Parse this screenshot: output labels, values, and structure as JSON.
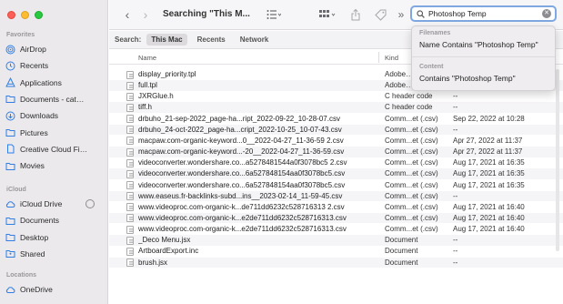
{
  "sidebar": {
    "sections": [
      {
        "title": "Favorites"
      },
      {
        "title": "iCloud"
      },
      {
        "title": "Locations"
      }
    ],
    "favorites": [
      {
        "label": "AirDrop",
        "icon": "airdrop-icon"
      },
      {
        "label": "Recents",
        "icon": "clock-icon"
      },
      {
        "label": "Applications",
        "icon": "applications-icon"
      },
      {
        "label": "Documents - cat…",
        "icon": "folder-icon"
      },
      {
        "label": "Downloads",
        "icon": "downloads-icon"
      },
      {
        "label": "Pictures",
        "icon": "folder-icon"
      },
      {
        "label": "Creative Cloud Fi…",
        "icon": "document-icon"
      },
      {
        "label": "Movies",
        "icon": "folder-icon"
      }
    ],
    "icloud": [
      {
        "label": "iCloud Drive",
        "icon": "cloud-icon"
      },
      {
        "label": "Documents",
        "icon": "folder-icon"
      },
      {
        "label": "Desktop",
        "icon": "folder-icon"
      },
      {
        "label": "Shared",
        "icon": "shared-folder-icon"
      }
    ],
    "locations": [
      {
        "label": "OneDrive",
        "icon": "cloud-icon"
      }
    ]
  },
  "toolbar": {
    "title": "Searching \"This M...",
    "back_glyph": "‹",
    "forward_glyph": "›",
    "more_glyph": "»"
  },
  "search": {
    "value": "Photoshop Temp"
  },
  "scope": {
    "label": "Search:",
    "options": [
      "This Mac",
      "Recents",
      "Network"
    ],
    "selected": "This Mac"
  },
  "columns": {
    "name": "Name",
    "kind": "Kind"
  },
  "dropdown": {
    "filenames_header": "Filenames",
    "filenames_item": "Name Contains \"Photoshop Temp\"",
    "content_header": "Content",
    "content_item": "Contains \"Photoshop Temp\""
  },
  "files": [
    {
      "name": "display_priority.tpl",
      "kind": "Adobe…",
      "date": ""
    },
    {
      "name": "full.tpl",
      "kind": "Adobe…",
      "date": ""
    },
    {
      "name": "JXRGlue.h",
      "kind": "C header code",
      "date": "--"
    },
    {
      "name": "tiff.h",
      "kind": "C header code",
      "date": "--"
    },
    {
      "name": "drbuho_21-sep-2022_page-ha...ript_2022-09-22_10-28-07.csv",
      "kind": "Comm...et (.csv)",
      "date": "Sep 22, 2022 at 10:28"
    },
    {
      "name": "drbuho_24-oct-2022_page-ha...cript_2022-10-25_10-07-43.csv",
      "kind": "Comm...et (.csv)",
      "date": "--"
    },
    {
      "name": "macpaw.com-organic-keyword...0__2022-04-27_11-36-59 2.csv",
      "kind": "Comm...et (.csv)",
      "date": "Apr 27, 2022 at 11:37"
    },
    {
      "name": "macpaw.com-organic-keyword...-20__2022-04-27_11-36-59.csv",
      "kind": "Comm...et (.csv)",
      "date": "Apr 27, 2022 at 11:37"
    },
    {
      "name": "videoconverter.wondershare.co...a5278481544a0f3078bc5 2.csv",
      "kind": "Comm...et (.csv)",
      "date": "Aug 17, 2021 at 16:35"
    },
    {
      "name": "videoconverter.wondershare.co...6a527848154aa0f3078bc5.csv",
      "kind": "Comm...et (.csv)",
      "date": "Aug 17, 2021 at 16:35"
    },
    {
      "name": "videoconverter.wondershare.co...6a527848154aa0f3078bc5.csv",
      "kind": "Comm...et (.csv)",
      "date": "Aug 17, 2021 at 16:35"
    },
    {
      "name": "www.easeus.fr-backlinks-subd...ins__2023-02-14_11-59-45.csv",
      "kind": "Comm...et (.csv)",
      "date": "--"
    },
    {
      "name": "www.videoproc.com-organic-k...de711dd6232c528716313 2.csv",
      "kind": "Comm...et (.csv)",
      "date": "Aug 17, 2021 at 16:40"
    },
    {
      "name": "www.videoproc.com-organic-k...e2de711dd6232c528716313.csv",
      "kind": "Comm...et (.csv)",
      "date": "Aug 17, 2021 at 16:40"
    },
    {
      "name": "www.videoproc.com-organic-k...e2de711dd6232c528716313.csv",
      "kind": "Comm...et (.csv)",
      "date": "Aug 17, 2021 at 16:40"
    },
    {
      "name": "_Deco Menu.jsx",
      "kind": "Document",
      "date": "--"
    },
    {
      "name": "ArtboardExport.inc",
      "kind": "Document",
      "date": "--"
    },
    {
      "name": "brush.jsx",
      "kind": "Document",
      "date": "--"
    }
  ]
}
